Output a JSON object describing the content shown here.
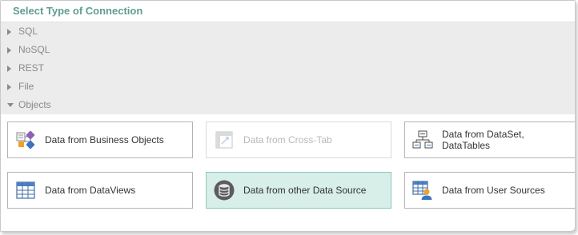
{
  "header": {
    "title": "Select Type of Connection"
  },
  "categories": [
    {
      "label": "SQL",
      "expanded": false
    },
    {
      "label": "NoSQL",
      "expanded": false
    },
    {
      "label": "REST",
      "expanded": false
    },
    {
      "label": "File",
      "expanded": false
    },
    {
      "label": "Objects",
      "expanded": true
    }
  ],
  "items": [
    {
      "label": "Data from Business Objects",
      "icon": "business-objects-icon",
      "state": "normal"
    },
    {
      "label": "Data from Cross-Tab",
      "icon": "cross-tab-icon",
      "state": "disabled"
    },
    {
      "label_line1": "Data from DataSet,",
      "label_line2": "DataTables",
      "icon": "dataset-icon",
      "state": "normal"
    },
    {
      "label": "Data from DataViews",
      "icon": "dataview-table-icon",
      "state": "normal"
    },
    {
      "label": "Data from other Data Source",
      "icon": "database-icon",
      "state": "selected"
    },
    {
      "label": "Data from User Sources",
      "icon": "user-source-icon",
      "state": "normal"
    }
  ],
  "colors": {
    "header_text": "#5f9d8f",
    "category_bg": "#ececec",
    "selected_bg": "#d7eee9",
    "selected_border": "#8ec7b9"
  }
}
